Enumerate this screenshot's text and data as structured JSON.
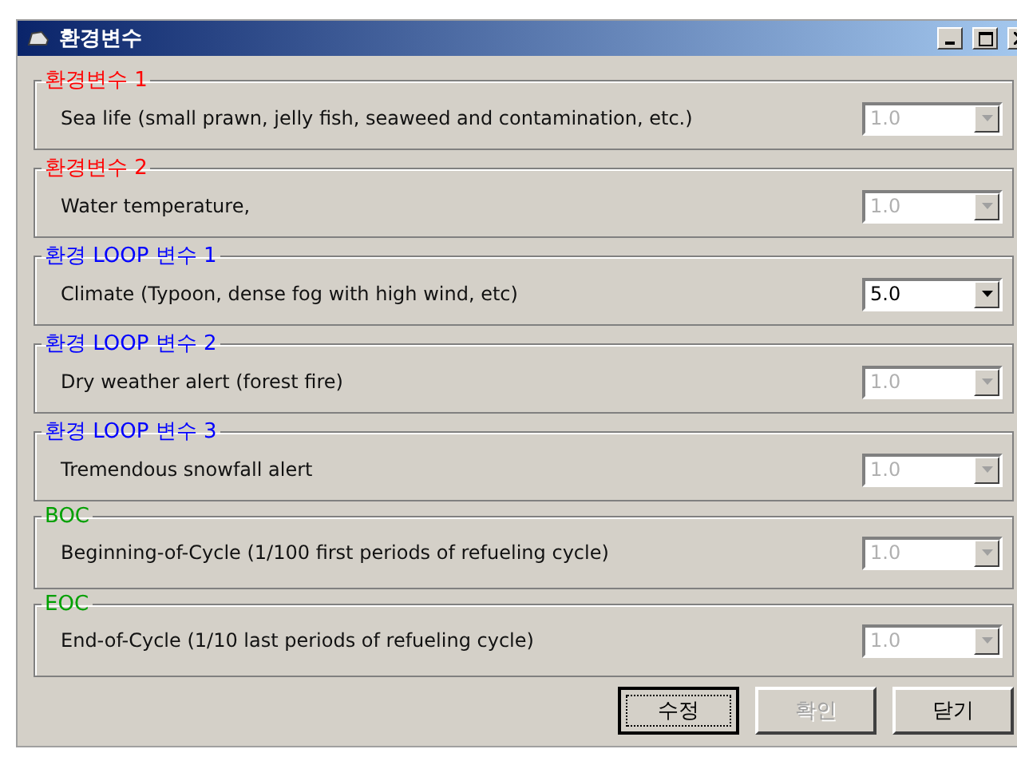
{
  "window": {
    "title": "환경변수"
  },
  "groups": [
    {
      "label": "환경변수 1",
      "color": "#ff0000",
      "description": "Sea life (small prawn, jelly fish, seaweed and contamination, etc.)",
      "value": "1.0",
      "disabled": true
    },
    {
      "label": "환경변수 2",
      "color": "#ff0000",
      "description": "Water temperature,",
      "value": "1.0",
      "disabled": true
    },
    {
      "label": "환경 LOOP 변수 1",
      "color": "#0000ff",
      "description": "Climate (Typoon, dense fog with high wind, etc)",
      "value": "5.0",
      "disabled": false
    },
    {
      "label": "환경 LOOP 변수 2",
      "color": "#0000ff",
      "description": "Dry weather alert (forest fire)",
      "value": "1.0",
      "disabled": true
    },
    {
      "label": "환경 LOOP 변수 3",
      "color": "#0000ff",
      "description": "Tremendous snowfall alert",
      "value": "1.0",
      "disabled": true
    },
    {
      "label": "BOC",
      "color": "#00a000",
      "description": "Beginning-of-Cycle (1/100 first periods of refueling cycle)",
      "value": "1.0",
      "disabled": true
    },
    {
      "label": "EOC",
      "color": "#00a000",
      "description": "End-of-Cycle (1/10 last periods of refueling cycle)",
      "value": "1.0",
      "disabled": true
    }
  ],
  "buttons": [
    {
      "label": "수정",
      "disabled": false,
      "focused": true
    },
    {
      "label": "확인",
      "disabled": true,
      "focused": false
    },
    {
      "label": "닫기",
      "disabled": false,
      "focused": false
    }
  ]
}
